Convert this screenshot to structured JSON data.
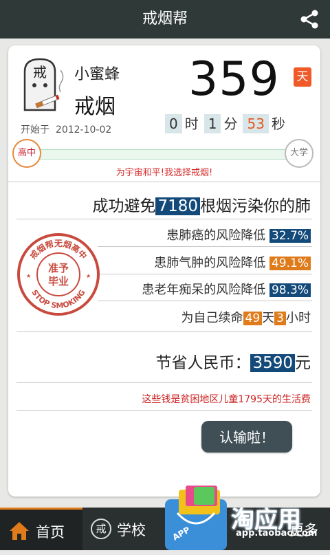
{
  "header": {
    "title": "戒烟帮"
  },
  "profile": {
    "tomb_char": "戒",
    "username": "小蜜蜂",
    "status": "戒烟",
    "start_label": "开始于",
    "start_date": "2012-10-02"
  },
  "counter": {
    "days": "359",
    "day_unit": "天",
    "hours": "0",
    "hours_unit": "时",
    "minutes": "1",
    "minutes_unit": "分",
    "seconds": "53",
    "seconds_unit": "秒"
  },
  "progress": {
    "start_stage": "高中",
    "end_stage": "大学",
    "fraction": 0.0,
    "slogan": "为宇宙和平!我选择戒烟!"
  },
  "health": {
    "avoid_prefix": "成功避免",
    "avoid_count": "7180",
    "avoid_suffix": "根烟污染你的肺",
    "items": [
      {
        "label": "患肺癌的风险降低",
        "value": "32.7%",
        "color": "blue"
      },
      {
        "label": "患肺气肿的风险降低",
        "value": "49.1%",
        "color": "orange"
      },
      {
        "label": "患老年痴呆的风险降低",
        "value": "98.3%",
        "color": "blue"
      }
    ],
    "life_prefix": "为自己续命",
    "life_days": "49",
    "life_days_unit": "天",
    "life_hours": "3",
    "life_hours_unit": "小时"
  },
  "stamp": {
    "top_text": "戒烟帮无烟高中",
    "center_line1": "准予",
    "center_line2": "毕业",
    "bottom_text": "STOP SMOKING"
  },
  "money": {
    "label": "节省人民币：",
    "amount": "3590",
    "unit": "元",
    "poverty_text": "这些钱是贫困地区儿童1795天的生活费"
  },
  "actions": {
    "give_up": "认输啦！"
  },
  "tabbar": {
    "tabs": [
      {
        "label": "首页",
        "icon": "home-icon"
      },
      {
        "label": "学校",
        "icon": "school-icon",
        "icon_char": "戒"
      },
      {
        "label": "更多",
        "icon": "more-icon"
      }
    ]
  },
  "watermark": {
    "app_label": "APP",
    "title": "淘应用",
    "url": "app.taobao.com"
  },
  "colors": {
    "accent_orange": "#e07b1b",
    "accent_blue": "#134a7a",
    "alert_red": "#d42a2a",
    "header_bg": "#2f3a38"
  }
}
